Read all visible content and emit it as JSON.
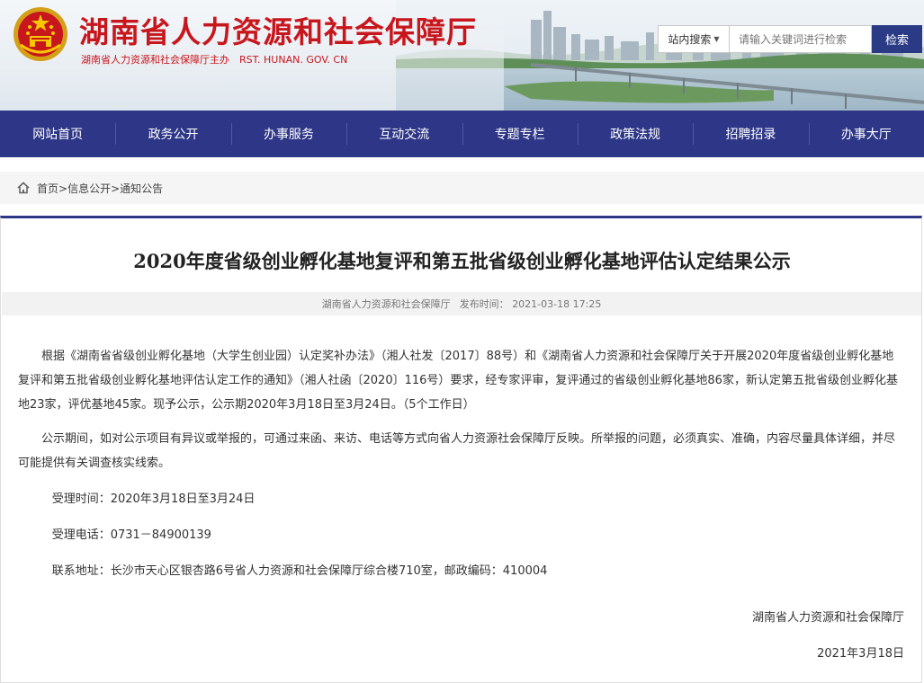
{
  "header": {
    "title": "湖南省人力资源和社会保障厅",
    "subtitle": "湖南省人力资源和社会保障厅主办　RST. HUNAN. GOV. CN"
  },
  "search": {
    "scope": "站内搜索",
    "placeholder": "请输入关键词进行检索",
    "button": "检索"
  },
  "nav": {
    "items": [
      "网站首页",
      "政务公开",
      "办事服务",
      "互动交流",
      "专题专栏",
      "政策法规",
      "招聘招录",
      "办事大厅"
    ]
  },
  "breadcrumb": {
    "items": [
      "首页",
      ">信息公开",
      ">通知公告"
    ]
  },
  "article": {
    "title": "2020年度省级创业孵化基地复评和第五批省级创业孵化基地评估认定结果公示",
    "source": "湖南省人力资源和社会保障厅",
    "publish_label": "发布时间：",
    "publish_time": "2021-03-18 17:25",
    "paragraph1": "根据《湖南省省级创业孵化基地（大学生创业园）认定奖补办法》（湘人社发〔2017〕88号）和《湖南省人力资源和社会保障厅关于开展2020年度省级创业孵化基地复评和第五批省级创业孵化基地评估认定工作的通知》（湘人社函〔2020〕116号）要求，经专家评审，复评通过的省级创业孵化基地86家，新认定第五批省级创业孵化基地23家，评优基地45家。现予公示，公示期2020年3月18日至3月24日。（5个工作日）",
    "paragraph2": "公示期间，如对公示项目有异议或举报的，可通过来函、来访、电话等方式向省人力资源社会保障厅反映。所举报的问题，必须真实、准确，内容尽量具体详细，并尽可能提供有关调查核实线索。",
    "accept_time": "受理时间：2020年3月18日至3月24日",
    "accept_phone": "受理电话：0731－84900139",
    "address": "联系地址：长沙市天心区银杏路6号省人力资源和社会保障厅综合楼710室，邮政编码：410004",
    "signature": "湖南省人力资源和社会保障厅",
    "date": "2021年3月18日"
  },
  "colors": {
    "brand_red": "#c8161d",
    "nav_blue": "#2d3687",
    "search_button": "#2a3a85"
  }
}
